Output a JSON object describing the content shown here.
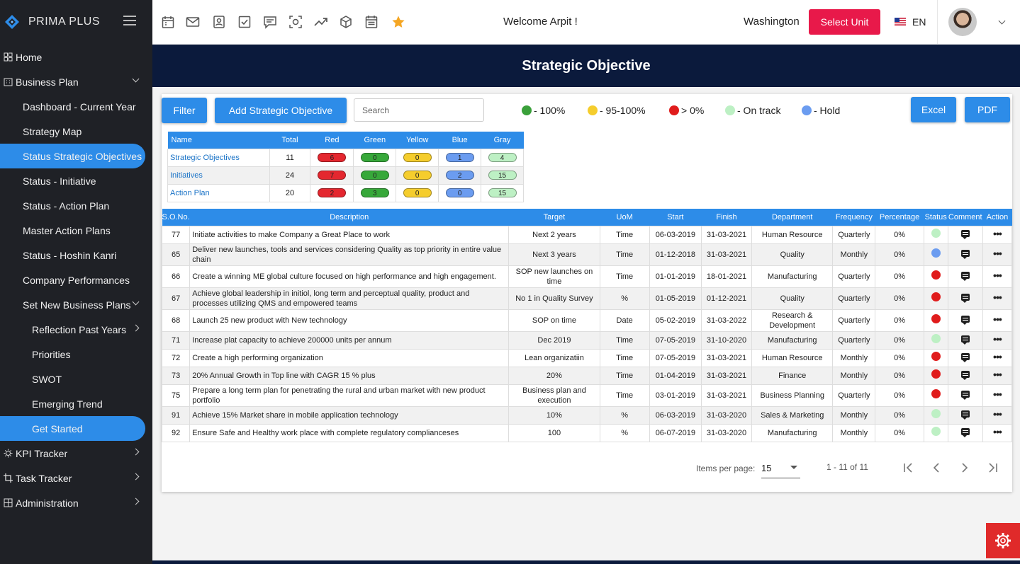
{
  "sidebar": {
    "brand": "PRIMA PLUS",
    "items": [
      {
        "label": "Home"
      },
      {
        "label": "Business Plan"
      },
      {
        "label": "Dashboard - Current Year"
      },
      {
        "label": "Strategy Map"
      },
      {
        "label": "Status Strategic Objectives"
      },
      {
        "label": "Status - Initiative"
      },
      {
        "label": "Status - Action Plan"
      },
      {
        "label": "Master Action Plans"
      },
      {
        "label": "Status - Hoshin Kanri"
      },
      {
        "label": "Company Performances"
      },
      {
        "label": "Set New Business Plans"
      },
      {
        "label": "Reflection Past Years"
      },
      {
        "label": "Priorities"
      },
      {
        "label": "SWOT"
      },
      {
        "label": "Emerging Trend"
      },
      {
        "label": "Get Started"
      },
      {
        "label": "KPI Tracker"
      },
      {
        "label": "Task Tracker"
      },
      {
        "label": "Administration"
      }
    ]
  },
  "topbar": {
    "welcome": "Welcome  Arpit !",
    "city": "Washington",
    "select_unit": "Select Unit",
    "lang": "EN",
    "icons": [
      "calendar-icon",
      "mail-icon",
      "contact-icon",
      "checkbox-icon",
      "notes-icon",
      "scan-icon",
      "trend-icon",
      "box-icon",
      "schedule-icon",
      "star-icon"
    ]
  },
  "page": {
    "title": "Strategic Objective"
  },
  "toolbar": {
    "filter": "Filter",
    "add": "Add Strategic Objective",
    "search_placeholder": "Search",
    "excel": "Excel",
    "pdf": "PDF",
    "legend": [
      {
        "label": "- 100%",
        "color": "#3aa03a"
      },
      {
        "label": "- 95-100%",
        "color": "#f5cd2d"
      },
      {
        "label": "> 0%",
        "color": "#e01c1c"
      },
      {
        "label": "- On track",
        "color": "#bdf0c4"
      },
      {
        "label": "- Hold",
        "color": "#6b9cf0"
      }
    ]
  },
  "summary": {
    "headers": [
      "Name",
      "Total",
      "Red",
      "Green",
      "Yellow",
      "Blue",
      "Gray"
    ],
    "pill_colors": [
      "#e4272f",
      "#37a83a",
      "#f5cd2d",
      "#6b9cf0",
      "#bdf0c4"
    ],
    "rows": [
      {
        "name": "Strategic Objectives",
        "total": "11",
        "red": "6",
        "green": "0",
        "yellow": "0",
        "blue": "1",
        "gray": "4"
      },
      {
        "name": "Initiatives",
        "total": "24",
        "red": "7",
        "green": "0",
        "yellow": "0",
        "blue": "2",
        "gray": "15"
      },
      {
        "name": "Action Plan",
        "total": "20",
        "red": "2",
        "green": "3",
        "yellow": "0",
        "blue": "0",
        "gray": "15"
      }
    ]
  },
  "table": {
    "headers": [
      "S.O.No.",
      "Description",
      "Target",
      "UoM",
      "Start",
      "Finish",
      "Department",
      "Frequency",
      "Percentage",
      "Status",
      "Comment",
      "Action"
    ],
    "rows": [
      {
        "no": "77",
        "desc": "Initiate activities to make Company a Great Place to work",
        "target": "Next 2 years",
        "uom": "Time",
        "start": "06-03-2019",
        "finish": "31-03-2021",
        "dept": "Human Resource",
        "freq": "Quarterly",
        "pct": "0%",
        "status": "#bdf0c4"
      },
      {
        "no": "65",
        "desc": "Deliver new launches, tools and services considering Quality as top priority in entire value chain",
        "target": "Next 3 years",
        "uom": "Time",
        "start": "01-12-2018",
        "finish": "31-03-2021",
        "dept": "Quality",
        "freq": "Monthly",
        "pct": "0%",
        "status": "#6b9cf0"
      },
      {
        "no": "66",
        "desc": "Create a winning ME global culture focused on high performance and high engagement.",
        "target": "SOP new launches on time",
        "uom": "Time",
        "start": "01-01-2019",
        "finish": "18-01-2021",
        "dept": "Manufacturing",
        "freq": "Quarterly",
        "pct": "0%",
        "status": "#e01c1c"
      },
      {
        "no": "67",
        "desc": "Achieve global leadership in initiol, long term and perceptual quality, product and processes utilizing QMS and empowered teams",
        "target": "No 1 in Quality Survey",
        "uom": "%",
        "start": "01-05-2019",
        "finish": "01-12-2021",
        "dept": "Quality",
        "freq": "Quarterly",
        "pct": "0%",
        "status": "#e01c1c"
      },
      {
        "no": "68",
        "desc": "Launch 25 new product with New technology",
        "target": "SOP on time",
        "uom": "Date",
        "start": "05-02-2019",
        "finish": "31-03-2022",
        "dept": "Research & Development",
        "freq": "Quarterly",
        "pct": "0%",
        "status": "#e01c1c"
      },
      {
        "no": "71",
        "desc": "Increase plat capacity to achieve 200000 units per annum",
        "target": "Dec 2019",
        "uom": "Time",
        "start": "07-05-2019",
        "finish": "31-10-2020",
        "dept": "Manufacturing",
        "freq": "Quarterly",
        "pct": "0%",
        "status": "#bdf0c4"
      },
      {
        "no": "72",
        "desc": "Create a high performing organization",
        "target": "Lean organizatiin",
        "uom": "Time",
        "start": "07-05-2019",
        "finish": "31-03-2021",
        "dept": "Human Resource",
        "freq": "Monthly",
        "pct": "0%",
        "status": "#e01c1c"
      },
      {
        "no": "73",
        "desc": "20% Annual Growth in Top line with CAGR 15 % plus",
        "target": "20%",
        "uom": "Time",
        "start": "01-04-2019",
        "finish": "31-03-2021",
        "dept": "Finance",
        "freq": "Monthly",
        "pct": "0%",
        "status": "#e01c1c"
      },
      {
        "no": "75",
        "desc": "Prepare a long term plan for penetrating the rural and urban market with new product portfolio",
        "target": "Business plan and execution",
        "uom": "Time",
        "start": "03-01-2019",
        "finish": "31-03-2021",
        "dept": "Business Planning",
        "freq": "Quarterly",
        "pct": "0%",
        "status": "#e01c1c"
      },
      {
        "no": "91",
        "desc": "Achieve 15% Market share in mobile application technology",
        "target": "10%",
        "uom": "%",
        "start": "06-03-2019",
        "finish": "31-03-2020",
        "dept": "Sales & Marketing",
        "freq": "Monthly",
        "pct": "0%",
        "status": "#bdf0c4"
      },
      {
        "no": "92",
        "desc": "Ensure Safe and Healthy work place with complete regulatory complianceses",
        "target": "100",
        "uom": "%",
        "start": "06-07-2019",
        "finish": "31-03-2020",
        "dept": "Manufacturing",
        "freq": "Monthly",
        "pct": "0%",
        "status": "#bdf0c4"
      }
    ]
  },
  "pagination": {
    "items_label": "Items per page:",
    "per_page": "15",
    "range": "1 - 11 of 11"
  },
  "colors": {
    "accent": "#2d8ce8",
    "sidebar": "#1f2126",
    "title_band": "#0b1a3c",
    "danger": "#e8194a"
  }
}
